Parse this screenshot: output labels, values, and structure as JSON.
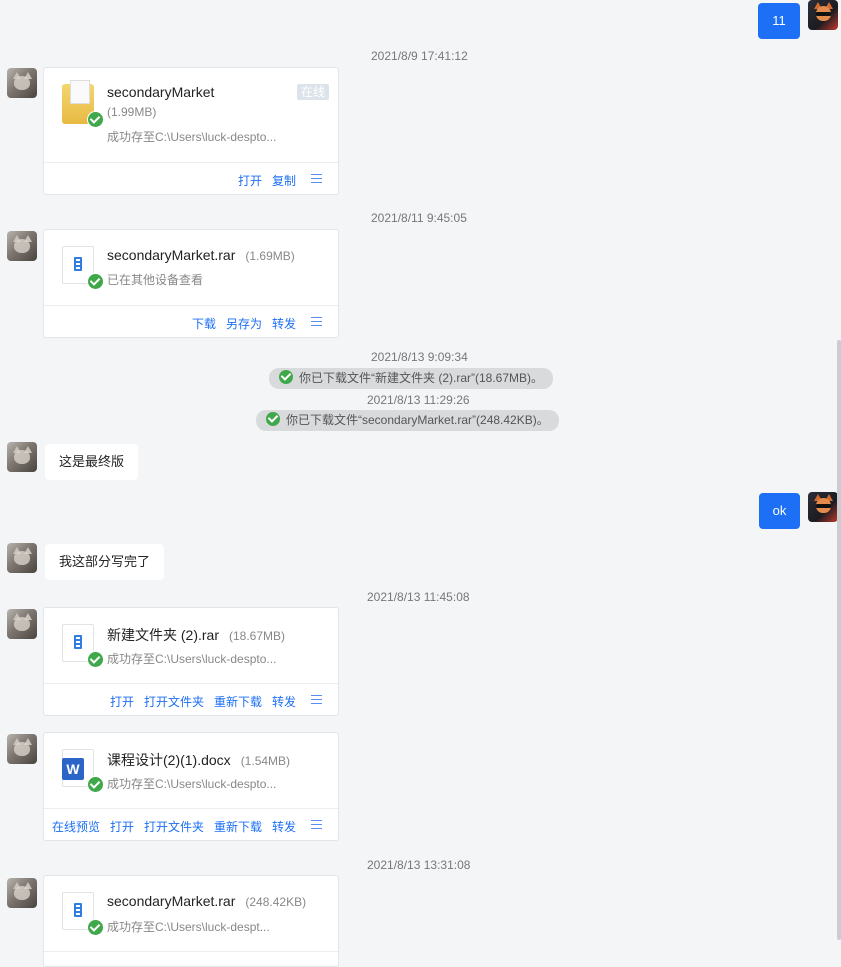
{
  "messages": {
    "m1": {
      "text": "11"
    },
    "t1": "2021/8/9 17:41:12",
    "card1": {
      "file_name": "secondaryMarket",
      "file_size": "(1.99MB)",
      "online_badge": "在线",
      "status": "成功存至C:\\Users\\luck-despto...",
      "actions": [
        "打开",
        "复制"
      ]
    },
    "t2": "2021/8/11 9:45:05",
    "card2": {
      "file_name": "secondaryMarket.rar",
      "file_size": "(1.69MB)",
      "status": "已在其他设备查看",
      "actions": [
        "下载",
        "另存为",
        "转发"
      ]
    },
    "t3": "2021/8/13 9:09:34",
    "sys1": "你已下载文件“新建文件夹 (2).rar”(18.67MB)。",
    "t4": "2021/8/13 11:29:26",
    "sys2": "你已下载文件“secondaryMarket.rar”(248.42KB)。",
    "m2": {
      "text": "这是最终版"
    },
    "m3": {
      "text": "ok"
    },
    "m4": {
      "text": "我这部分写完了"
    },
    "t5": "2021/8/13 11:45:08",
    "card3": {
      "file_name": "新建文件夹 (2).rar",
      "file_size": "(18.67MB)",
      "status": "成功存至C:\\Users\\luck-despto...",
      "actions": [
        "打开",
        "打开文件夹",
        "重新下载",
        "转发"
      ]
    },
    "card4": {
      "file_name": "课程设计(2)(1).docx",
      "file_size": "(1.54MB)",
      "status": "成功存至C:\\Users\\luck-despto...",
      "actions": [
        "在线预览",
        "打开",
        "打开文件夹",
        "重新下载",
        "转发"
      ]
    },
    "t6": "2021/8/13 13:31:08",
    "card5": {
      "file_name": "secondaryMarket.rar",
      "file_size": "(248.42KB)",
      "status": "成功存至C:\\Users\\luck-despt..."
    }
  },
  "icons": {
    "menu": "menu-icon",
    "check": "check-circle-icon",
    "zip": "zip-file-icon",
    "folder": "folder-icon",
    "word": "word-file-icon"
  },
  "colors": {
    "accent": "#1d6ff5",
    "success": "#3fa84a",
    "background": "#f4f5f7"
  }
}
